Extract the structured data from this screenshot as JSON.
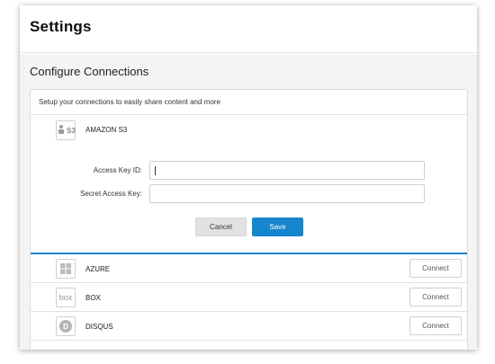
{
  "header": {
    "title": "Settings"
  },
  "connections": {
    "section_title": "Configure Connections",
    "description": "Setup your connections to easily share content and more",
    "expanded": {
      "name": "AMAZON S3",
      "logo_text": "S3",
      "icon": "amazon-s3-icon",
      "fields": [
        {
          "label": "Access Key ID:",
          "value": "",
          "placeholder": ""
        },
        {
          "label": "Secret Access Key:",
          "value": "",
          "placeholder": ""
        }
      ],
      "cancel_label": "Cancel",
      "save_label": "Save"
    },
    "services": [
      {
        "name": "AZURE",
        "icon": "windows-icon",
        "connect_label": "Connect"
      },
      {
        "name": "BOX",
        "icon": "box-icon",
        "logo_text": "box",
        "connect_label": "Connect"
      },
      {
        "name": "DISQUS",
        "icon": "disqus-icon",
        "logo_text": "D",
        "connect_label": "Connect"
      }
    ]
  },
  "colors": {
    "accent": "#1585cd",
    "divider": "#1c86c8"
  }
}
